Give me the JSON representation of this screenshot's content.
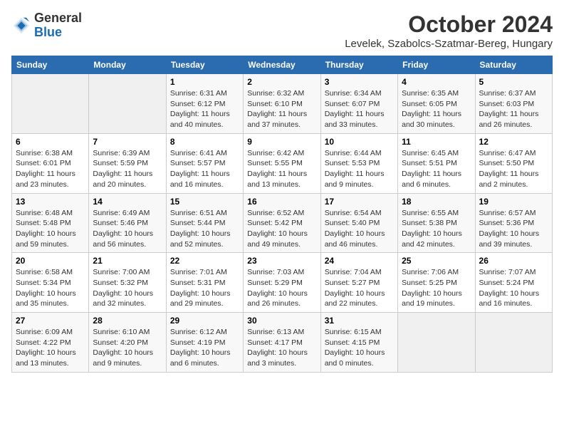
{
  "header": {
    "logo_general": "General",
    "logo_blue": "Blue",
    "month_title": "October 2024",
    "location": "Levelek, Szabolcs-Szatmar-Bereg, Hungary"
  },
  "weekdays": [
    "Sunday",
    "Monday",
    "Tuesday",
    "Wednesday",
    "Thursday",
    "Friday",
    "Saturday"
  ],
  "weeks": [
    [
      {
        "day": "",
        "info": ""
      },
      {
        "day": "",
        "info": ""
      },
      {
        "day": "1",
        "info": "Sunrise: 6:31 AM\nSunset: 6:12 PM\nDaylight: 11 hours and 40 minutes."
      },
      {
        "day": "2",
        "info": "Sunrise: 6:32 AM\nSunset: 6:10 PM\nDaylight: 11 hours and 37 minutes."
      },
      {
        "day": "3",
        "info": "Sunrise: 6:34 AM\nSunset: 6:07 PM\nDaylight: 11 hours and 33 minutes."
      },
      {
        "day": "4",
        "info": "Sunrise: 6:35 AM\nSunset: 6:05 PM\nDaylight: 11 hours and 30 minutes."
      },
      {
        "day": "5",
        "info": "Sunrise: 6:37 AM\nSunset: 6:03 PM\nDaylight: 11 hours and 26 minutes."
      }
    ],
    [
      {
        "day": "6",
        "info": "Sunrise: 6:38 AM\nSunset: 6:01 PM\nDaylight: 11 hours and 23 minutes."
      },
      {
        "day": "7",
        "info": "Sunrise: 6:39 AM\nSunset: 5:59 PM\nDaylight: 11 hours and 20 minutes."
      },
      {
        "day": "8",
        "info": "Sunrise: 6:41 AM\nSunset: 5:57 PM\nDaylight: 11 hours and 16 minutes."
      },
      {
        "day": "9",
        "info": "Sunrise: 6:42 AM\nSunset: 5:55 PM\nDaylight: 11 hours and 13 minutes."
      },
      {
        "day": "10",
        "info": "Sunrise: 6:44 AM\nSunset: 5:53 PM\nDaylight: 11 hours and 9 minutes."
      },
      {
        "day": "11",
        "info": "Sunrise: 6:45 AM\nSunset: 5:51 PM\nDaylight: 11 hours and 6 minutes."
      },
      {
        "day": "12",
        "info": "Sunrise: 6:47 AM\nSunset: 5:50 PM\nDaylight: 11 hours and 2 minutes."
      }
    ],
    [
      {
        "day": "13",
        "info": "Sunrise: 6:48 AM\nSunset: 5:48 PM\nDaylight: 10 hours and 59 minutes."
      },
      {
        "day": "14",
        "info": "Sunrise: 6:49 AM\nSunset: 5:46 PM\nDaylight: 10 hours and 56 minutes."
      },
      {
        "day": "15",
        "info": "Sunrise: 6:51 AM\nSunset: 5:44 PM\nDaylight: 10 hours and 52 minutes."
      },
      {
        "day": "16",
        "info": "Sunrise: 6:52 AM\nSunset: 5:42 PM\nDaylight: 10 hours and 49 minutes."
      },
      {
        "day": "17",
        "info": "Sunrise: 6:54 AM\nSunset: 5:40 PM\nDaylight: 10 hours and 46 minutes."
      },
      {
        "day": "18",
        "info": "Sunrise: 6:55 AM\nSunset: 5:38 PM\nDaylight: 10 hours and 42 minutes."
      },
      {
        "day": "19",
        "info": "Sunrise: 6:57 AM\nSunset: 5:36 PM\nDaylight: 10 hours and 39 minutes."
      }
    ],
    [
      {
        "day": "20",
        "info": "Sunrise: 6:58 AM\nSunset: 5:34 PM\nDaylight: 10 hours and 35 minutes."
      },
      {
        "day": "21",
        "info": "Sunrise: 7:00 AM\nSunset: 5:32 PM\nDaylight: 10 hours and 32 minutes."
      },
      {
        "day": "22",
        "info": "Sunrise: 7:01 AM\nSunset: 5:31 PM\nDaylight: 10 hours and 29 minutes."
      },
      {
        "day": "23",
        "info": "Sunrise: 7:03 AM\nSunset: 5:29 PM\nDaylight: 10 hours and 26 minutes."
      },
      {
        "day": "24",
        "info": "Sunrise: 7:04 AM\nSunset: 5:27 PM\nDaylight: 10 hours and 22 minutes."
      },
      {
        "day": "25",
        "info": "Sunrise: 7:06 AM\nSunset: 5:25 PM\nDaylight: 10 hours and 19 minutes."
      },
      {
        "day": "26",
        "info": "Sunrise: 7:07 AM\nSunset: 5:24 PM\nDaylight: 10 hours and 16 minutes."
      }
    ],
    [
      {
        "day": "27",
        "info": "Sunrise: 6:09 AM\nSunset: 4:22 PM\nDaylight: 10 hours and 13 minutes."
      },
      {
        "day": "28",
        "info": "Sunrise: 6:10 AM\nSunset: 4:20 PM\nDaylight: 10 hours and 9 minutes."
      },
      {
        "day": "29",
        "info": "Sunrise: 6:12 AM\nSunset: 4:19 PM\nDaylight: 10 hours and 6 minutes."
      },
      {
        "day": "30",
        "info": "Sunrise: 6:13 AM\nSunset: 4:17 PM\nDaylight: 10 hours and 3 minutes."
      },
      {
        "day": "31",
        "info": "Sunrise: 6:15 AM\nSunset: 4:15 PM\nDaylight: 10 hours and 0 minutes."
      },
      {
        "day": "",
        "info": ""
      },
      {
        "day": "",
        "info": ""
      }
    ]
  ]
}
